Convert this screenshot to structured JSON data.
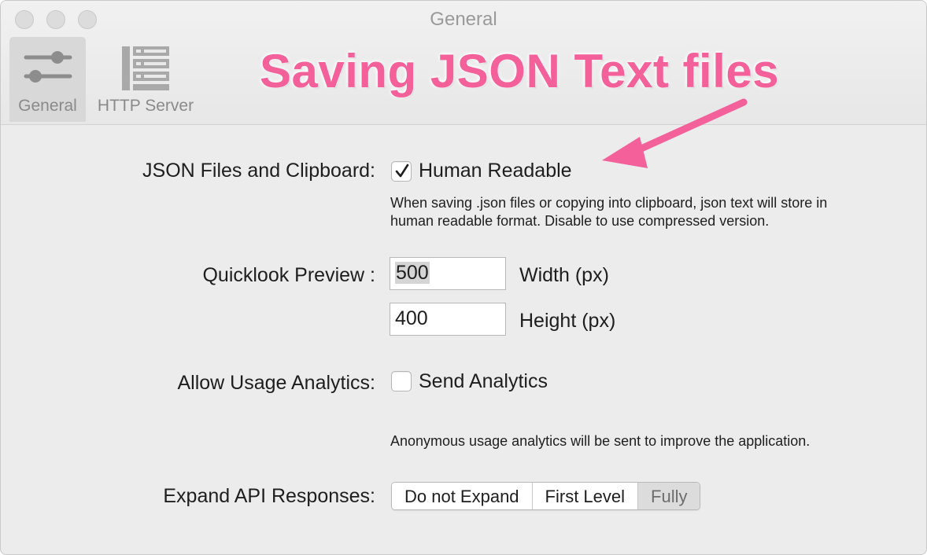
{
  "window": {
    "title": "General"
  },
  "toolbar": {
    "tabs": [
      {
        "label": "General",
        "icon": "sliders-icon",
        "selected": true
      },
      {
        "label": "HTTP Server",
        "icon": "server-icon",
        "selected": false
      }
    ]
  },
  "annotation": {
    "text": "Saving JSON Text files",
    "color": "#f4609a"
  },
  "json_files": {
    "label": "JSON Files and Clipboard:",
    "checkbox_label": "Human Readable",
    "checked": true,
    "help_line1": "When saving .json files or copying into clipboard, json text will store in",
    "help_line2": "human readable format. Disable to use compressed version."
  },
  "quicklook": {
    "label": "Quicklook Preview :",
    "width_value": "500",
    "width_unit": "Width (px)",
    "height_value": "400",
    "height_unit": "Height (px)"
  },
  "analytics": {
    "label": "Allow Usage Analytics:",
    "checkbox_label": "Send Analytics",
    "checked": false,
    "help": "Anonymous usage analytics will be sent to improve the application."
  },
  "expand": {
    "label": "Expand API Responses:",
    "options": [
      "Do not Expand",
      "First Level",
      "Fully"
    ],
    "selected": "Fully"
  }
}
